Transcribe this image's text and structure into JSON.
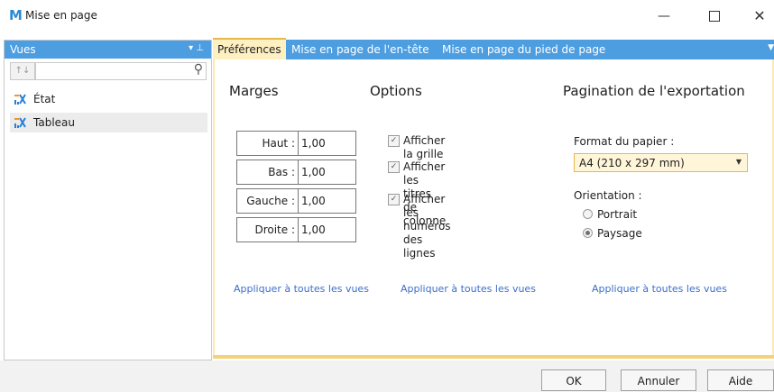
{
  "window": {
    "logo": "M",
    "title": "Mise en page",
    "minimize": "—",
    "close": "✕"
  },
  "left_panel": {
    "header": "Vues",
    "pin": "▾ ⊥",
    "sort": "↑↓",
    "search": {
      "value": "",
      "placeholder": ""
    },
    "items": [
      {
        "label": "État",
        "selected": false,
        "icon": "report-icon"
      },
      {
        "label": "Tableau",
        "selected": true,
        "icon": "table-icon"
      }
    ]
  },
  "tabs": [
    {
      "label": "Préférences",
      "active": true
    },
    {
      "label": "Mise en page de l'en-tête",
      "active": false
    },
    {
      "label": "Mise en page du pied de page",
      "active": false
    }
  ],
  "margins": {
    "title": "Marges",
    "rows": [
      {
        "label": "Haut :",
        "value": "1,00"
      },
      {
        "label": "Bas :",
        "value": "1,00"
      },
      {
        "label": "Gauche :",
        "value": "1,00"
      },
      {
        "label": "Droite :",
        "value": "1,00"
      }
    ],
    "apply_link": "Appliquer à toutes les vues"
  },
  "options": {
    "title": "Options",
    "items": [
      {
        "label_line1": "Afficher la grille",
        "label_line2": "",
        "checked": true
      },
      {
        "label_line1": "Afficher les titres de",
        "label_line2": "colonne",
        "checked": true
      },
      {
        "label_line1": "Afficher les numéros des",
        "label_line2": "lignes",
        "checked": true
      }
    ],
    "apply_link": "Appliquer à toutes les vues"
  },
  "pagination": {
    "title": "Pagination de l'exportation",
    "paper_label": "Format du papier :",
    "paper_value": "A4 (210 x 297 mm)",
    "orientation_label": "Orientation :",
    "orientations": [
      {
        "label": "Portrait",
        "selected": false
      },
      {
        "label": "Paysage",
        "selected": true
      }
    ],
    "apply_link": "Appliquer à toutes les vues"
  },
  "footer": {
    "ok": "OK",
    "cancel": "Annuler",
    "help": "Aide"
  },
  "colors": {
    "accent_blue": "#4d9ee0",
    "tab_active_bg": "#fff0c2",
    "link": "#3b6fcb",
    "select_border": "#e5b94b"
  }
}
